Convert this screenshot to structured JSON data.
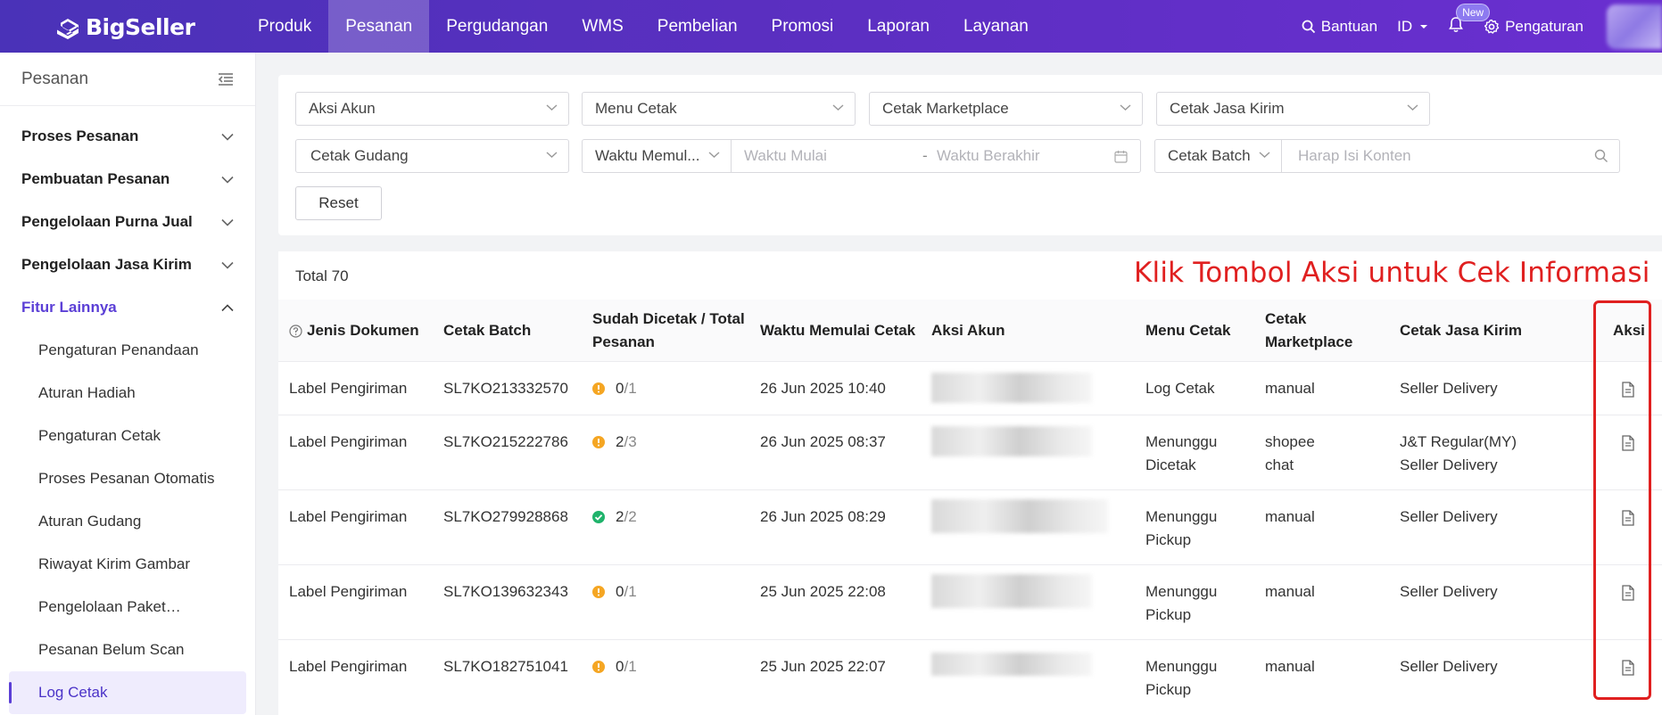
{
  "app": {
    "logo_text": "BigSeller"
  },
  "nav": {
    "items": [
      "Produk",
      "Pesanan",
      "Pergudangan",
      "WMS",
      "Pembelian",
      "Promosi",
      "Laporan",
      "Layanan"
    ],
    "active": "Pesanan"
  },
  "topright": {
    "help": "Bantuan",
    "lang": "ID",
    "new_badge": "New",
    "settings": "Pengaturan"
  },
  "sidebar": {
    "title": "Pesanan",
    "groups": [
      {
        "label": "Proses Pesanan",
        "open": false
      },
      {
        "label": "Pembuatan Pesanan",
        "open": false
      },
      {
        "label": "Pengelolaan Purna Jual",
        "open": false
      },
      {
        "label": "Pengelolaan Jasa Kirim",
        "open": false
      },
      {
        "label": "Fitur Lainnya",
        "open": true
      }
    ],
    "subitems": [
      "Pengaturan Penandaan",
      "Aturan Hadiah",
      "Pengaturan Cetak",
      "Proses Pesanan Otomatis",
      "Aturan Gudang",
      "Riwayat Kirim Gambar",
      "Pengelolaan Paket…",
      "Pesanan Belum Scan",
      "Log Cetak"
    ],
    "active_sub": "Log Cetak"
  },
  "filters": {
    "aksi_akun": "Aksi Akun",
    "menu_cetak": "Menu Cetak",
    "cetak_marketplace": "Cetak Marketplace",
    "cetak_jasa_kirim": "Cetak Jasa Kirim",
    "cetak_gudang": "Cetak Gudang",
    "waktu_type": "Waktu Memul...",
    "waktu_mulai_placeholder": "Waktu Mulai",
    "range_sep": "-",
    "waktu_berakhir_placeholder": "Waktu Berakhir",
    "search_type": "Cetak Batch",
    "search_placeholder": "Harap Isi Konten",
    "reset": "Reset"
  },
  "table": {
    "total": "Total 70",
    "annotation": "Klik Tombol Aksi untuk Cek Informasi",
    "columns": {
      "jenis": "Jenis Dokumen",
      "batch": "Cetak Batch",
      "sudah_1": "Sudah Dicetak / Total",
      "sudah_2": "Pesanan",
      "waktu": "Waktu Memulai Cetak",
      "akun": "Aksi Akun",
      "menu": "Menu Cetak",
      "mp_1": "Cetak",
      "mp_2": "Marketplace",
      "jasa": "Cetak Jasa Kirim",
      "aksi": "Aksi"
    },
    "rows": [
      {
        "jenis": "Label Pengiriman",
        "batch": "SL7KO213332570",
        "status": "warn",
        "done": "0",
        "total": "/1",
        "waktu": "26 Jun 2025 10:40",
        "menu_1": "Log Cetak",
        "menu_2": "",
        "mp_1": "manual",
        "mp_2": "",
        "jasa_1": "Seller Delivery",
        "jasa_2": ""
      },
      {
        "jenis": "Label Pengiriman",
        "batch": "SL7KO215222786",
        "status": "warn",
        "done": "2",
        "total": "/3",
        "waktu": "26 Jun 2025 08:37",
        "menu_1": "Menunggu",
        "menu_2": "Dicetak",
        "mp_1": "shopee",
        "mp_2": "chat",
        "jasa_1": "J&T Regular(MY)",
        "jasa_2": "Seller Delivery"
      },
      {
        "jenis": "Label Pengiriman",
        "batch": "SL7KO279928868",
        "status": "ok",
        "done": "2",
        "total": "/2",
        "waktu": "26 Jun 2025 08:29",
        "menu_1": "Menunggu",
        "menu_2": "Pickup",
        "mp_1": "manual",
        "mp_2": "",
        "jasa_1": "Seller Delivery",
        "jasa_2": ""
      },
      {
        "jenis": "Label Pengiriman",
        "batch": "SL7KO139632343",
        "status": "warn",
        "done": "0",
        "total": "/1",
        "waktu": "25 Jun 2025 22:08",
        "menu_1": "Menunggu",
        "menu_2": "Pickup",
        "mp_1": "manual",
        "mp_2": "",
        "jasa_1": "Seller Delivery",
        "jasa_2": ""
      },
      {
        "jenis": "Label Pengiriman",
        "batch": "SL7KO182751041",
        "status": "warn",
        "done": "0",
        "total": "/1",
        "waktu": "25 Jun 2025 22:07",
        "menu_1": "Menunggu",
        "menu_2": "Pickup",
        "mp_1": "manual",
        "mp_2": "",
        "jasa_1": "Seller Delivery",
        "jasa_2": ""
      }
    ]
  },
  "colors": {
    "brand": "#5b3fd6",
    "warn": "#f5a623",
    "ok": "#1fb36b",
    "annotation": "#e02020"
  },
  "icons": {
    "help": "question-circle-icon",
    "search": "search-icon",
    "bell": "bell-icon",
    "settings": "gear-icon",
    "collapse": "menu-collapse-icon",
    "calendar": "calendar-icon",
    "action": "document-icon"
  }
}
